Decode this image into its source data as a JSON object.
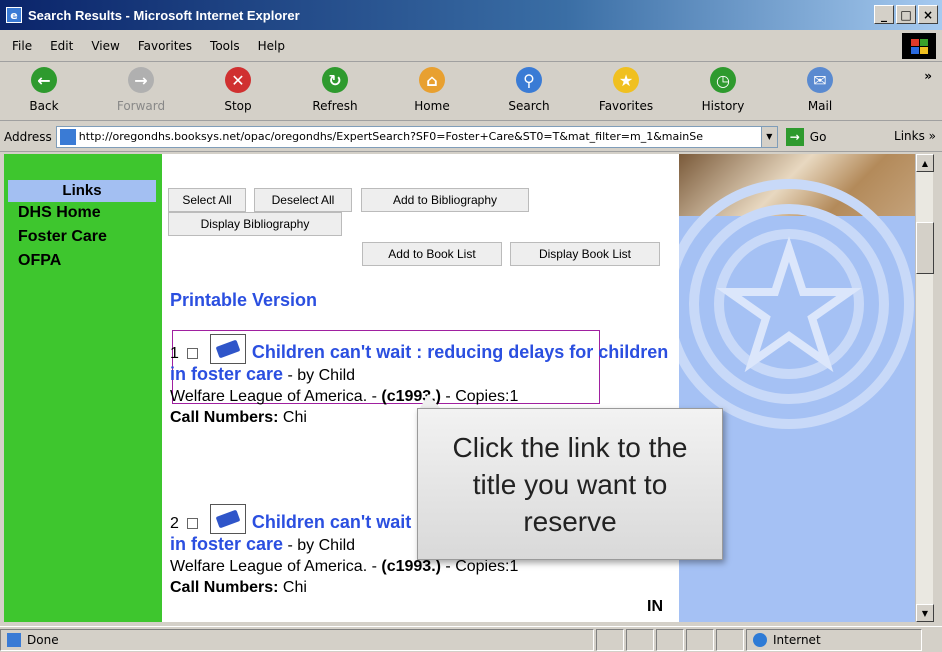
{
  "window": {
    "title": "Search Results - Microsoft Internet Explorer",
    "controls": [
      "_",
      "□",
      "×"
    ]
  },
  "menu": [
    "File",
    "Edit",
    "View",
    "Favorites",
    "Tools",
    "Help"
  ],
  "toolbar": [
    {
      "label": "Back",
      "icon": "back-icon",
      "color": "#2e9a2e",
      "glyph": "←"
    },
    {
      "label": "Forward",
      "icon": "forward-icon",
      "color": "#b0b0b0",
      "glyph": "→"
    },
    {
      "label": "Stop",
      "icon": "stop-icon",
      "color": "#d03030",
      "glyph": "✕"
    },
    {
      "label": "Refresh",
      "icon": "refresh-icon",
      "color": "#2e9a2e",
      "glyph": "↻"
    },
    {
      "label": "Home",
      "icon": "home-icon",
      "color": "#e8a030",
      "glyph": "⌂"
    },
    {
      "label": "Search",
      "icon": "search-icon",
      "color": "#3a7bd5",
      "glyph": "⚲"
    },
    {
      "label": "Favorites",
      "icon": "star-icon",
      "color": "#f0c020",
      "glyph": "★"
    },
    {
      "label": "History",
      "icon": "history-icon",
      "color": "#2e9a2e",
      "glyph": "◷"
    },
    {
      "label": "Mail",
      "icon": "mail-icon",
      "color": "#5a8ad0",
      "glyph": "✉"
    }
  ],
  "address": {
    "label": "Address",
    "url": "http://oregondhs.booksys.net/opac/oregondhs/ExpertSearch?SF0=Foster+Care&ST0=T&mat_filter=m_1&mainSe",
    "go": "Go",
    "links": "Links"
  },
  "sidebar": {
    "heading": "Links",
    "items": [
      "DHS Home",
      "Foster Care",
      "OFPA"
    ]
  },
  "actions": {
    "select_all": "Select All",
    "deselect_all": "Deselect All",
    "add_bibliography": "Add to Bibliography",
    "display_bibliography": "Display Bibliography",
    "add_book_list": "Add to Book List",
    "display_book_list": "Display Book List"
  },
  "printable": "Printable Version",
  "results": [
    {
      "num": "1",
      "title": "Children can't wait : reducing delays for children in foster care",
      "by": " - by Child",
      "line2": "Welfare League of America. - ",
      "year": "(c1993.)",
      "copies": " - Copies:1",
      "call_label": "Call Numbers:",
      "call": " Chi"
    },
    {
      "num": "2",
      "title": "Children can't wait : reducing delays for children in foster care",
      "by": " - by Child",
      "line2": "Welfare League of America. - ",
      "year": "(c1993.)",
      "copies": " - Copies:1",
      "call_label": "Call Numbers:",
      "call": " Chi",
      "status": "IN"
    }
  ],
  "callout": "Click the link to the title you want to reserve",
  "status": {
    "text": "Done",
    "zone": "Internet"
  }
}
